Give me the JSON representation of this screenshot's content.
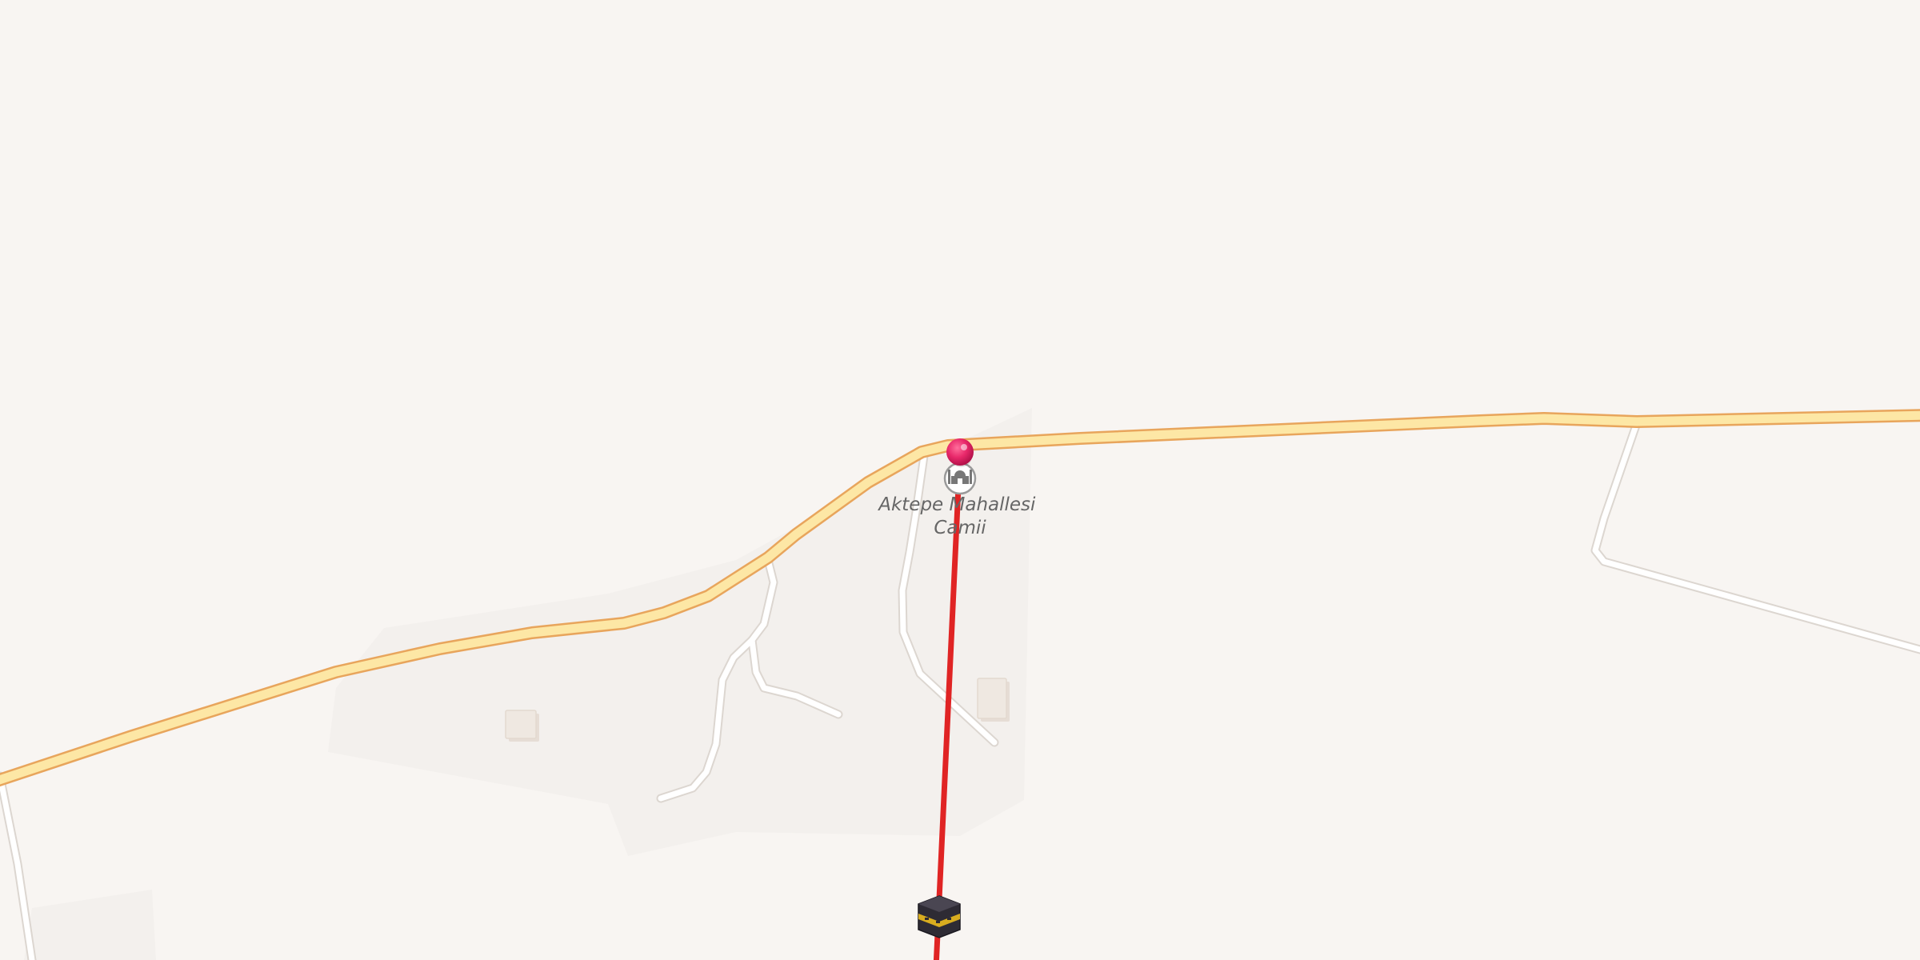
{
  "map": {
    "background_color": "#f8f5f2",
    "landuse_color": "#f3f0ed",
    "building_color": "#ede6df",
    "main_road": {
      "fill_color": "#fde7a5",
      "casing_color": "#e8a55c"
    },
    "minor_road": {
      "fill_color": "#ffffff",
      "casing_color": "#dcd6d0"
    },
    "poi": {
      "name_line1": "Aktepe Mahallesi",
      "name_line2": "Camii",
      "icon": "mosque-icon"
    },
    "marker": {
      "icon": "location-pin-icon",
      "color": "#e8286a"
    },
    "qibla_line": {
      "color": "#e02424"
    },
    "kaaba": {
      "icon": "kaaba-icon"
    }
  }
}
